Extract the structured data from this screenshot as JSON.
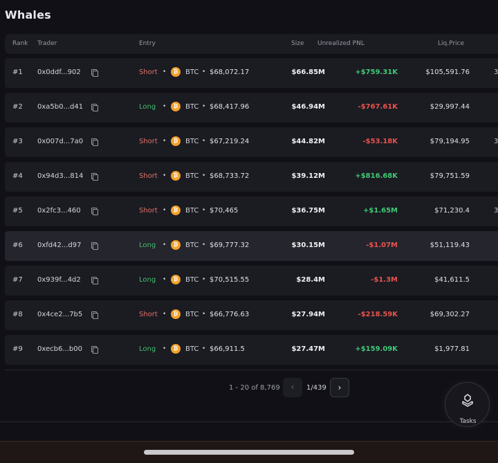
{
  "page_title": "Whales",
  "columns": {
    "rank": "Rank",
    "trader": "Trader",
    "entry": "Entry",
    "size": "Size",
    "pnl": "Unrealized PNL",
    "liq": "Liq.Price"
  },
  "rows": [
    {
      "rank": "#1",
      "address": "0x0ddf...902",
      "side": "Short",
      "asset": "BTC",
      "entry": "$68,072.17",
      "size": "$66.85M",
      "pnl": "+$759.31K",
      "liq": "$105,591.76",
      "extra": "3"
    },
    {
      "rank": "#2",
      "address": "0xa5b0...d41",
      "side": "Long",
      "asset": "BTC",
      "entry": "$68,417.96",
      "size": "$46.94M",
      "pnl": "-$767.61K",
      "liq": "$29,997.44",
      "extra": ""
    },
    {
      "rank": "#3",
      "address": "0x007d...7a0",
      "side": "Short",
      "asset": "BTC",
      "entry": "$67,219.24",
      "size": "$44.82M",
      "pnl": "-$53.18K",
      "liq": "$79,194.95",
      "extra": "3"
    },
    {
      "rank": "#4",
      "address": "0x94d3...814",
      "side": "Short",
      "asset": "BTC",
      "entry": "$68,733.72",
      "size": "$39.12M",
      "pnl": "+$816.68K",
      "liq": "$79,751.59",
      "extra": ""
    },
    {
      "rank": "#5",
      "address": "0x2fc3...460",
      "side": "Short",
      "asset": "BTC",
      "entry": "$70,465",
      "size": "$36.75M",
      "pnl": "+$1.65M",
      "liq": "$71,230.4",
      "extra": "3"
    },
    {
      "rank": "#6",
      "address": "0xfd42...d97",
      "side": "Long",
      "asset": "BTC",
      "entry": "$69,777.32",
      "size": "$30.15M",
      "pnl": "-$1.07M",
      "liq": "$51,119.43",
      "extra": ""
    },
    {
      "rank": "#7",
      "address": "0x939f...4d2",
      "side": "Long",
      "asset": "BTC",
      "entry": "$70,515.55",
      "size": "$28.4M",
      "pnl": "-$1.3M",
      "liq": "$41,611.5",
      "extra": ""
    },
    {
      "rank": "#8",
      "address": "0x4ce2...7b5",
      "side": "Short",
      "asset": "BTC",
      "entry": "$66,776.63",
      "size": "$27.94M",
      "pnl": "-$218.59K",
      "liq": "$69,302.27",
      "extra": ""
    },
    {
      "rank": "#9",
      "address": "0xecb6...b00",
      "side": "Long",
      "asset": "BTC",
      "entry": "$66,911.5",
      "size": "$27.47M",
      "pnl": "+$159.09K",
      "liq": "$1,977.81",
      "extra": ""
    }
  ],
  "pagination": {
    "range_label": "1 - 20 of 8,769",
    "page_label": "1/439",
    "prev_icon": "chevron-left",
    "next_icon": "chevron-right"
  },
  "tasks_button": {
    "label": "Tasks",
    "icon": "tasks-icon"
  },
  "colors": {
    "short": "#e07268",
    "long": "#3fbf6c",
    "positive": "#3fca74",
    "negative": "#e8544e",
    "btc": "#f3a12d"
  },
  "icons": {
    "copy": "copy-icon",
    "coin": "btc-icon"
  },
  "highlighted_row": 6
}
